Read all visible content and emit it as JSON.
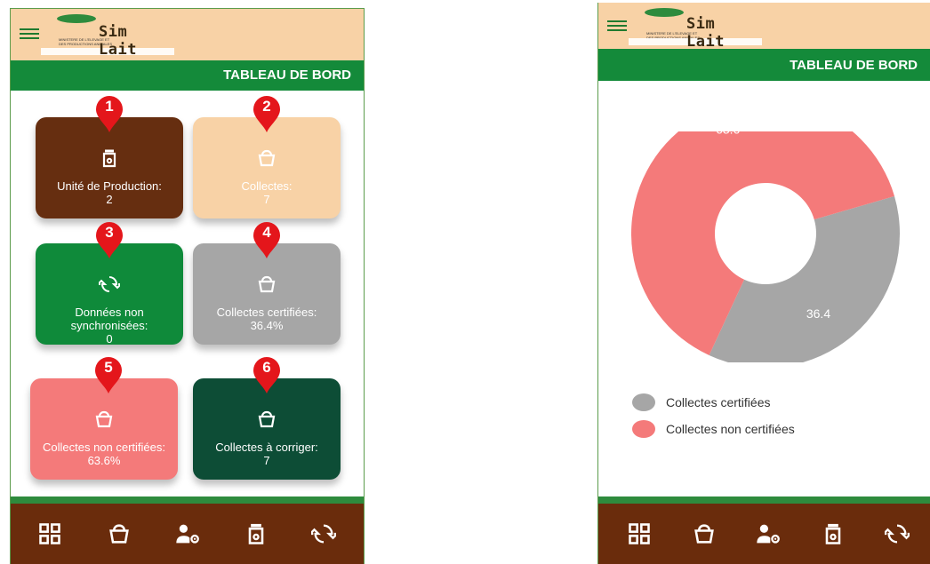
{
  "app": {
    "name": "Sim Lait",
    "logo_sub": "MINISTERE DE L'ELEVAGE ET DES PRODUCTIONS ANIMALES"
  },
  "header": {
    "title": "TABLEAU DE BORD"
  },
  "dashboard": {
    "cards": [
      {
        "badge": "1",
        "label": "Unité de Production:",
        "value": "2",
        "color": "#662e10",
        "icon": "jar-icon"
      },
      {
        "badge": "2",
        "label": "Collectes:",
        "value": "7",
        "color": "#f8d2a6",
        "icon": "bucket-icon"
      },
      {
        "badge": "3",
        "label": "Données non synchronisées:",
        "value": "0",
        "color": "#0f8a3a",
        "icon": "sync-icon"
      },
      {
        "badge": "4",
        "label": "Collectes certifiées:",
        "value": "36.4%",
        "color": "#a6a6a6",
        "icon": "bucket-icon"
      },
      {
        "badge": "5",
        "label": "Collectes non certifiées:",
        "value": "63.6%",
        "color": "#f47a7a",
        "icon": "bucket-icon"
      },
      {
        "badge": "6",
        "label": "Collectes à corriger:",
        "value": "7",
        "color": "#0d4d36",
        "icon": "bucket-icon"
      }
    ]
  },
  "bottom_nav": [
    "dashboard-grid-icon",
    "bucket-icon",
    "user-settings-icon",
    "jar-icon",
    "sync-icon"
  ],
  "chart_data": {
    "type": "pie",
    "donut": true,
    "title": "",
    "categories": [
      "Collectes certifiées",
      "Collectes non certifiées"
    ],
    "values": [
      36.4,
      63.6
    ],
    "value_labels": [
      "36.4",
      "63.6"
    ],
    "colors": [
      "#a6a6a6",
      "#f47a7a"
    ],
    "legend": "bottom-left"
  },
  "colors": {
    "accent": "#148a3a",
    "appbar": "#f8d2a6",
    "bottombar": "#6a2c0c",
    "badge": "#e4161b"
  }
}
